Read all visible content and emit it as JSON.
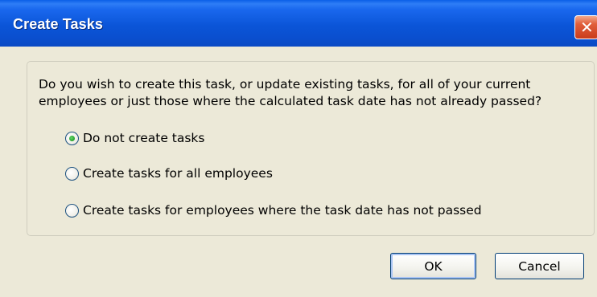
{
  "window": {
    "title": "Create Tasks",
    "close_glyph": "✕"
  },
  "dialog": {
    "question_line1": "Do you wish to create this task, or update existing tasks, for all of your current",
    "question_line2": "employees or just those where the calculated task date has not already passed?",
    "options": [
      {
        "label": "Do not create tasks",
        "selected": true
      },
      {
        "label": "Create tasks for all employees",
        "selected": false
      },
      {
        "label": "Create tasks for employees where the task date has not passed",
        "selected": false
      }
    ]
  },
  "buttons": {
    "ok_label": "OK",
    "cancel_label": "Cancel"
  },
  "colors": {
    "titlebar": "#0A55D8",
    "window_bg": "#ECE9D8",
    "radio_selected": "#2CA733",
    "close_button": "#E15F3C"
  },
  "icons": {
    "close": "close-icon",
    "radio_selected": "radio-selected-icon",
    "radio_unselected": "radio-unselected-icon"
  }
}
